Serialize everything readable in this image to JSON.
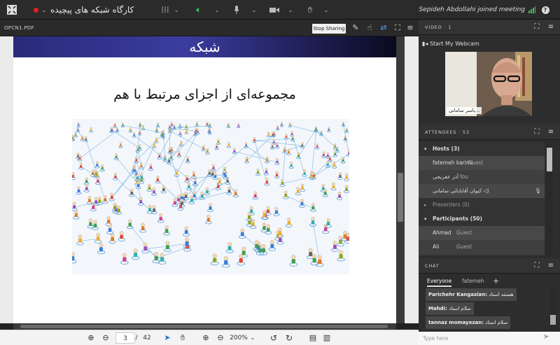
{
  "topbar": {
    "title": "کارگاه شبکه های پیچیده",
    "notice": "Sepideh Abdollahi joined meeting"
  },
  "share": {
    "file_label": "OPCN1.PDF",
    "stop_label": "Stop Sharing"
  },
  "slide": {
    "title": "شبکه",
    "subtitle": "مجموعه‌ای از اجزای مرتبط با هم"
  },
  "toolbar": {
    "current_page": "3",
    "separator": "/",
    "total_pages": "42",
    "zoom": "200%"
  },
  "video": {
    "label": "VIDEO",
    "count": "· 1",
    "webcam_label": "Start My Webcam",
    "presenter_name": "...یاسر سامانی"
  },
  "attendees": {
    "label": "ATTENDEES",
    "count": "· 53",
    "hosts_label": "Hosts (3)",
    "hosts": [
      {
        "name": "fatemeh karimi",
        "role": "Guest"
      },
      {
        "name": "آذر عفریجی",
        "role": "You"
      },
      {
        "name": "کیوان آقابابائی سامانی",
        "role": ""
      }
    ],
    "presenters_label": "Presenters (0)",
    "participants_label": "Participants (50)",
    "participants": [
      {
        "name": "Ahmad",
        "role": "Guest"
      },
      {
        "name": "Ali",
        "role": "Guest"
      }
    ]
  },
  "chat": {
    "label": "CHAT",
    "tabs": [
      "Everyone",
      "fatemeh",
      "+"
    ],
    "messages": [
      {
        "author": "Parichehr Kangazian:",
        "text": "هستند استاد"
      },
      {
        "author": "Mahdi:",
        "text": "سلام استاد"
      },
      {
        "author": "tannaz momayezan:",
        "text": "سلام استاد"
      }
    ],
    "placeholder": "Type here"
  },
  "colors": {
    "recording": "#e02020",
    "audio": "#3fbf5a",
    "signal": "#3fbf5a",
    "slide_band": "#2a2a7a"
  }
}
